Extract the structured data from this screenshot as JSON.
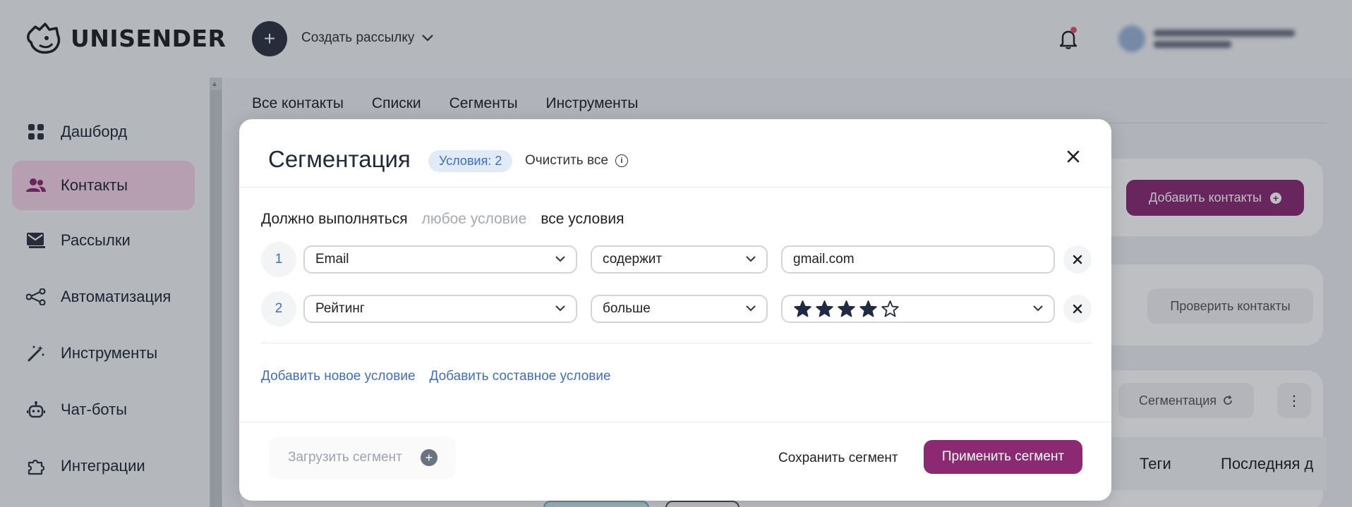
{
  "app": {
    "logo_text": "UNISENDER"
  },
  "topbar": {
    "create_label": "Создать рассылку"
  },
  "sidebar": {
    "items": [
      {
        "label": "Дашборд",
        "icon": "dashboard-icon"
      },
      {
        "label": "Контакты",
        "icon": "contacts-icon",
        "active": true
      },
      {
        "label": "Рассылки",
        "icon": "mail-icon"
      },
      {
        "label": "Автоматизация",
        "icon": "automation-icon"
      },
      {
        "label": "Инструменты",
        "icon": "magic-wand-icon"
      },
      {
        "label": "Чат-боты",
        "icon": "bot-icon"
      },
      {
        "label": "Интеграции",
        "icon": "puzzle-icon"
      }
    ]
  },
  "tabs": [
    "Все контакты",
    "Списки",
    "Сегменты",
    "Инструменты"
  ],
  "page": {
    "add_contacts": "Добавить контакты",
    "check_contacts": "Проверить контакты",
    "segmentation": "Сегментация",
    "columns": {
      "tags": "Теги",
      "last": "Последняя д"
    }
  },
  "modal": {
    "title": "Сегментация",
    "badge": "Условия: 2",
    "clear_all": "Очистить все",
    "must_label": "Должно выполняться",
    "any_condition": "любое условие",
    "all_conditions": "все условия",
    "rows": [
      {
        "num": "1",
        "field": "Email",
        "operator": "содержит",
        "value": "gmail.com"
      },
      {
        "num": "2",
        "field": "Рейтинг",
        "operator": "больше",
        "rating": 4,
        "rating_max": 5
      }
    ],
    "add_condition": "Добавить новое условие",
    "add_compound": "Добавить составное условие",
    "load_segment": "Загрузить сегмент",
    "save_segment": "Сохранить сегмент",
    "apply_segment": "Применить сегмент"
  },
  "colors": {
    "brand": "#8b2a73",
    "accent_link": "#3e6dc3",
    "active_nav": "#f4d3e6"
  }
}
